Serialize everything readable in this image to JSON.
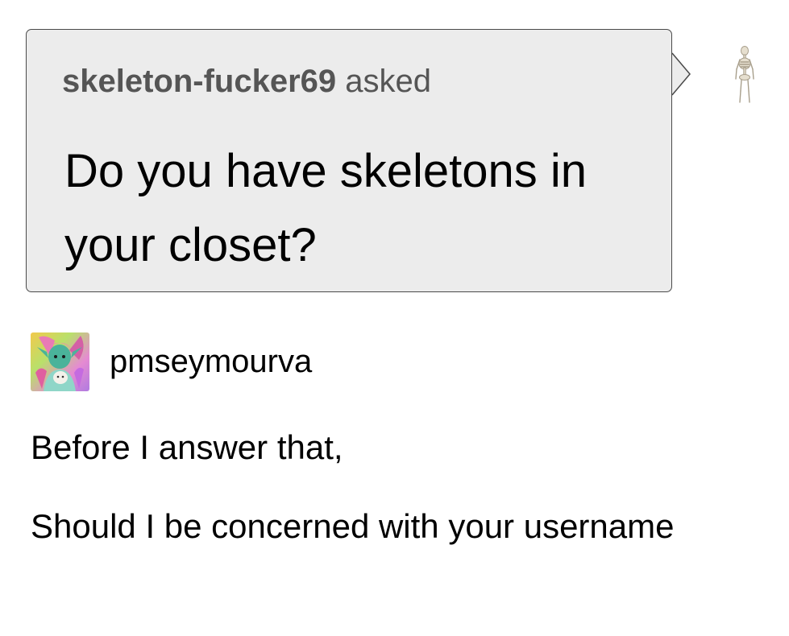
{
  "ask": {
    "asker_name": "skeleton-fucker69",
    "asked_label": "asked",
    "question": "Do you have skeletons in your closet?"
  },
  "answer": {
    "answerer_name": "pmseymourva",
    "paragraphs": [
      "Before I answer that,",
      "Should I be concerned with your username"
    ]
  },
  "icons": {
    "asker_avatar": "skeleton-icon",
    "answerer_avatar": "character-avatar"
  },
  "colors": {
    "bubble_background": "#ececec",
    "bubble_border": "#4a4a4a",
    "ask_header_text": "#555555",
    "body_text": "#000000"
  }
}
